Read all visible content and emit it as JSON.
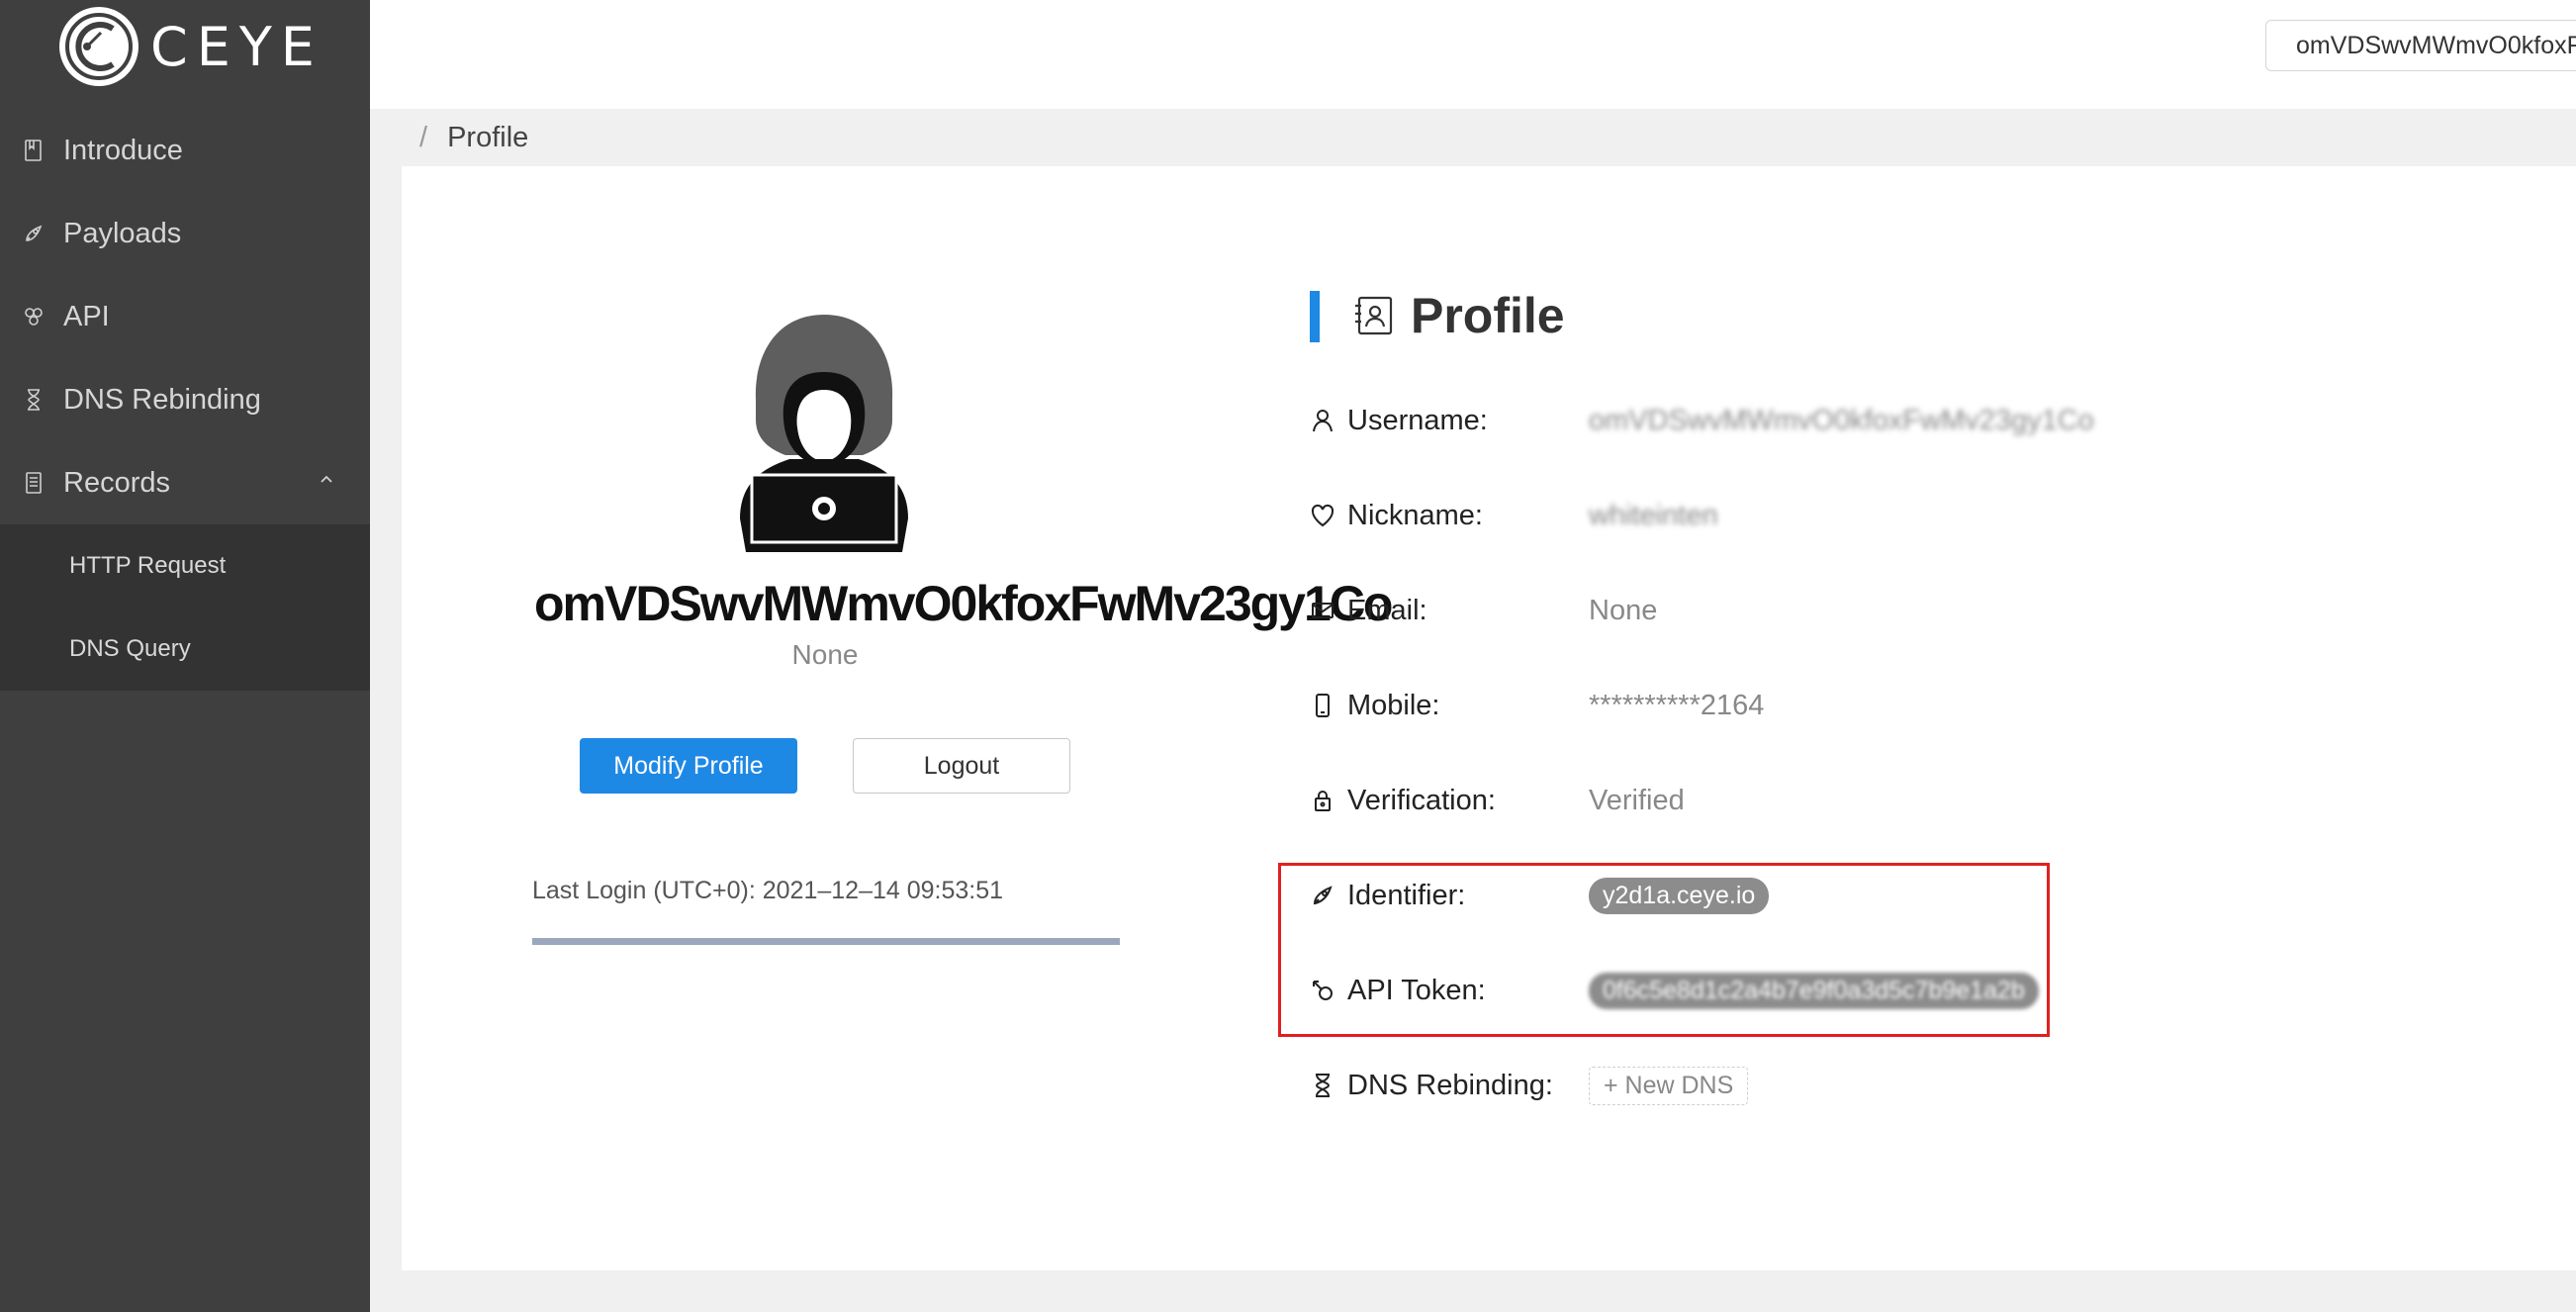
{
  "app": {
    "logo_text": "CEYE"
  },
  "sidebar": {
    "items": [
      {
        "label": "Introduce",
        "icon": "book-icon"
      },
      {
        "label": "Payloads",
        "icon": "rocket-icon"
      },
      {
        "label": "API",
        "icon": "api-icon"
      },
      {
        "label": "DNS Rebinding",
        "icon": "hourglass-icon"
      },
      {
        "label": "Records",
        "icon": "records-icon",
        "expanded": true
      }
    ],
    "submenu": [
      {
        "label": "HTTP Request"
      },
      {
        "label": "DNS Query"
      }
    ]
  },
  "header": {
    "user": "omVDSwvMWmvO0kfoxF"
  },
  "breadcrumb": {
    "separator": "/",
    "current": "Profile"
  },
  "profile_card": {
    "handle": "omVDSwvMWmvO0kfoxFwMv23gy1Co",
    "sub": "None",
    "modify_button": "Modify Profile",
    "logout_button": "Logout",
    "last_login": "Last Login (UTC+0): 2021–12–14 09:53:51",
    "progress": 1.0
  },
  "details": {
    "title": "Profile",
    "rows": [
      {
        "label": "Username:",
        "value": "omVDSwvMWmvO0kfoxFwMv23gy1Co",
        "blurred": true,
        "icon": "user-icon"
      },
      {
        "label": "Nickname:",
        "value": "whiteinten",
        "blurred": true,
        "icon": "heart-icon"
      },
      {
        "label": "Email:",
        "value": "None",
        "icon": "mail-icon"
      },
      {
        "label": "Mobile:",
        "value": "**********2164",
        "icon": "mobile-icon"
      },
      {
        "label": "Verification:",
        "value": "Verified",
        "icon": "lock-icon"
      },
      {
        "label": "Identifier:",
        "value": "y2d1a.ceye.io",
        "pill": true,
        "icon": "rocket-icon"
      },
      {
        "label": "API Token:",
        "value": "0f6c5e8d1c2a4b7e9f0a3d5c7b9e1a2b",
        "pill": true,
        "icon": "key-icon"
      },
      {
        "label": "DNS Rebinding:",
        "button": "+ New DNS",
        "icon": "hourglass-icon"
      }
    ]
  },
  "colors": {
    "sidebar": "#3f3f3f",
    "submenu": "#333333",
    "primary": "#1e88e5",
    "highlight": "#e02020"
  }
}
